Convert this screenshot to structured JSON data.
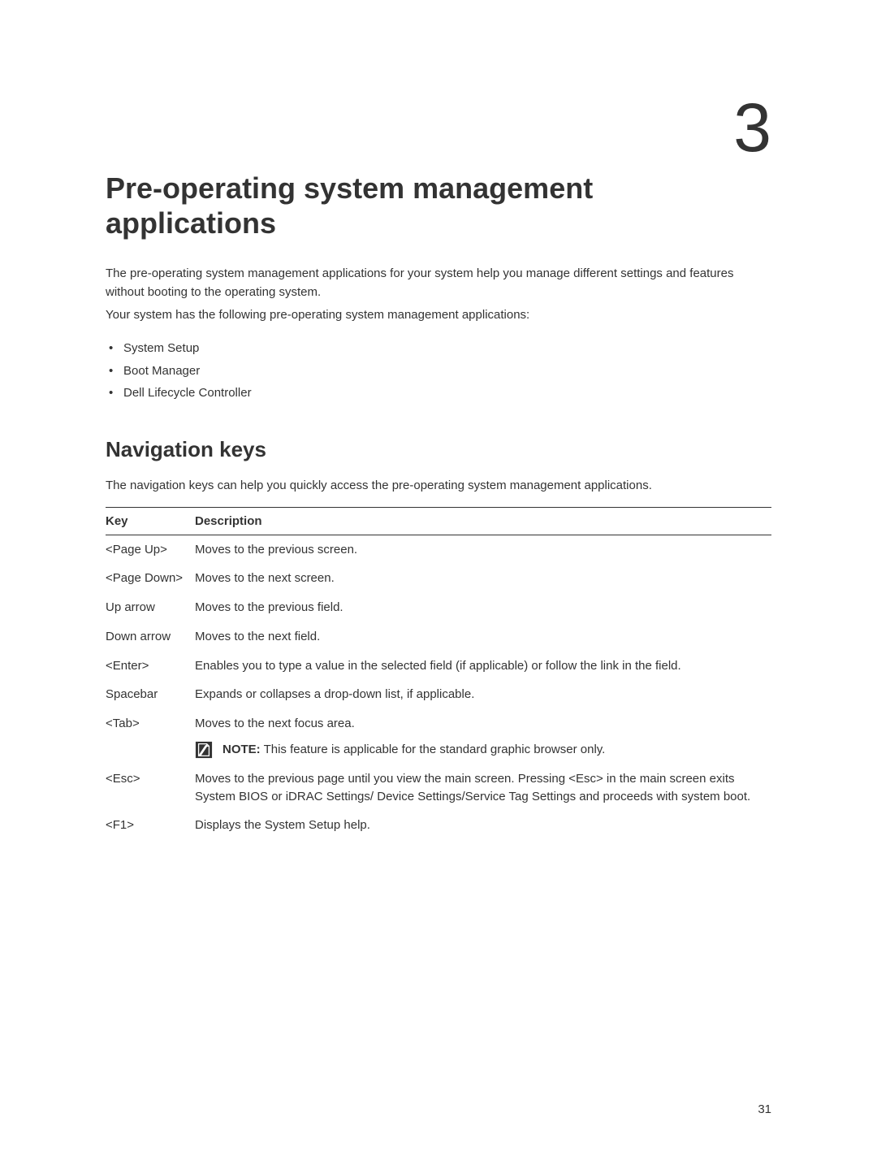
{
  "chapter_number": "3",
  "title": "Pre-operating system management applications",
  "intro": {
    "p1": "The pre-operating system management applications for your system help you manage different settings and features without booting to the operating system.",
    "p2": "Your system has the following pre-operating system management applications:"
  },
  "applications": [
    "System Setup",
    "Boot Manager",
    "Dell Lifecycle Controller"
  ],
  "nav_section": {
    "heading": "Navigation keys",
    "intro": "The navigation keys can help you quickly access the pre-operating system management applications.",
    "headers": {
      "key": "Key",
      "description": "Description"
    },
    "rows": [
      {
        "key": "<Page Up>",
        "desc": "Moves to the previous screen."
      },
      {
        "key": "<Page Down>",
        "desc": "Moves to the next screen."
      },
      {
        "key": "Up arrow",
        "desc": "Moves to the previous field."
      },
      {
        "key": "Down arrow",
        "desc": "Moves to the next field."
      },
      {
        "key": "<Enter>",
        "desc": "Enables you to type a value in the selected field (if applicable) or follow the link in the field."
      },
      {
        "key": "Spacebar",
        "desc": "Expands or collapses a drop-down list, if applicable."
      },
      {
        "key": "<Tab>",
        "desc": "Moves to the next focus area.",
        "note_label": "NOTE:",
        "note_text": " This feature is applicable for the standard graphic browser only."
      },
      {
        "key": "<Esc>",
        "desc": "Moves to the previous page until you view the main screen. Pressing <Esc> in the main screen exits System BIOS or iDRAC Settings/ Device Settings/Service Tag Settings and proceeds with system boot."
      },
      {
        "key": "<F1>",
        "desc": "Displays the System Setup help."
      }
    ]
  },
  "page_number": "31"
}
